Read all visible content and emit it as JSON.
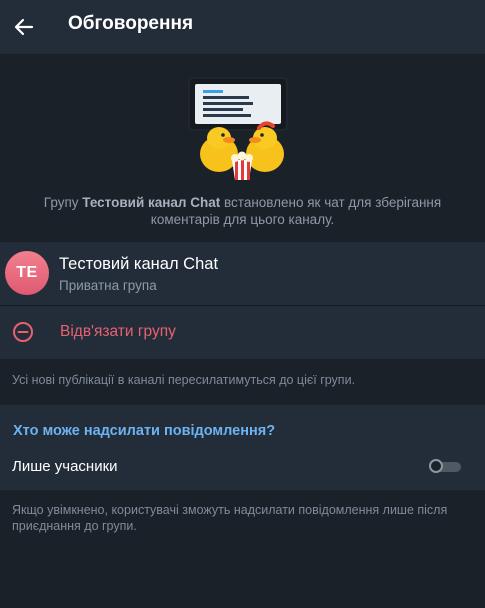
{
  "header": {
    "title": "Обговорення",
    "back_icon": "back-arrow-icon"
  },
  "hero": {
    "sticker_icon": "ducks-with-popcorn-sticker",
    "desc_before": "Групу ",
    "desc_group": "Тестовий канал Chat",
    "desc_after": " встановлено як чат для зберігання коментарів для цього каналу."
  },
  "group": {
    "avatar_initials": "TE",
    "avatar_color": "#e8687c",
    "name": "Тестовий канал Chat",
    "type": "Приватна група"
  },
  "unlink": {
    "label": "Відв'язати групу",
    "icon": "minus-circle-icon",
    "color": "#e8616f"
  },
  "hint_forward": "Усі нові публікації в каналі пересилатимуться до цієї групи.",
  "permissions": {
    "title": "Хто може надсилати повідомлення?",
    "title_color": "#6db3f2",
    "members_only_label": "Лише учасники",
    "members_only_enabled": false,
    "hint": "Якщо увімкнено, користувачі зможуть надсилати повідомлення лише після приєднання до групи."
  }
}
